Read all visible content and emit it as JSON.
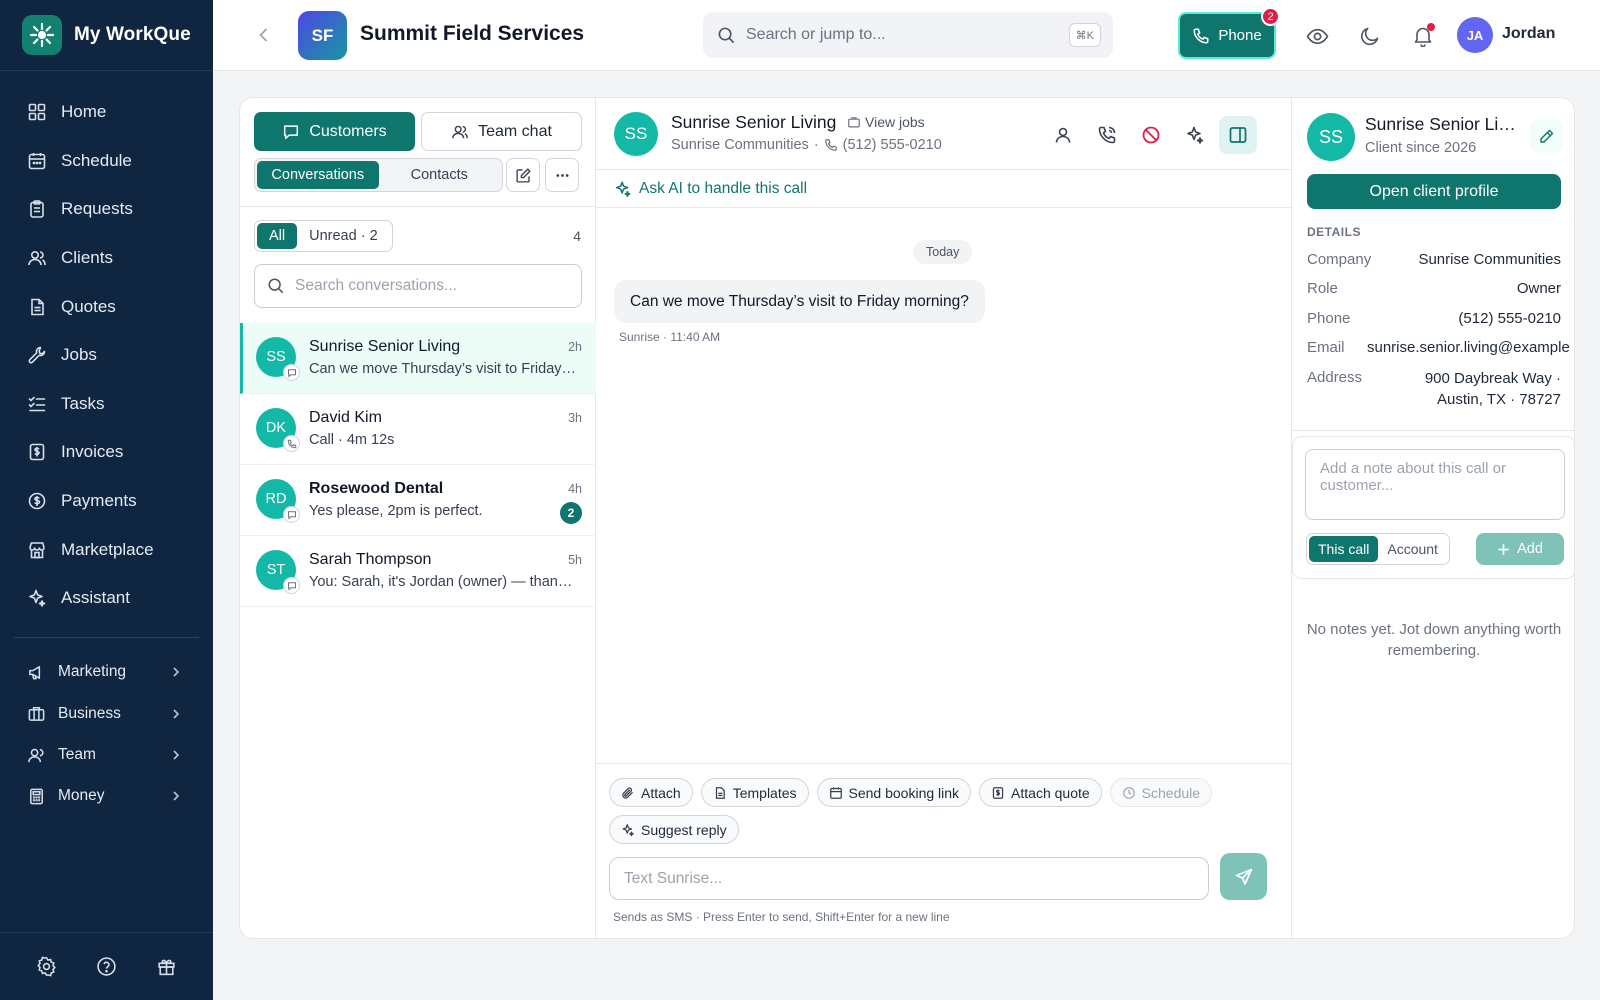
{
  "sidebar": {
    "brand": "My WorkQue",
    "items": [
      {
        "label": "Home",
        "icon": "home-icon"
      },
      {
        "label": "Schedule",
        "icon": "calendar-icon"
      },
      {
        "label": "Requests",
        "icon": "clipboard-icon"
      },
      {
        "label": "Clients",
        "icon": "users-icon"
      },
      {
        "label": "Quotes",
        "icon": "document-icon"
      },
      {
        "label": "Jobs",
        "icon": "wrench-icon"
      },
      {
        "label": "Tasks",
        "icon": "checklist-icon"
      },
      {
        "label": "Invoices",
        "icon": "invoice-icon"
      },
      {
        "label": "Payments",
        "icon": "dollar-circle-icon"
      },
      {
        "label": "Marketplace",
        "icon": "store-icon"
      },
      {
        "label": "Assistant",
        "icon": "sparkle-icon"
      }
    ],
    "groups": [
      {
        "label": "Marketing",
        "icon": "megaphone-icon"
      },
      {
        "label": "Business",
        "icon": "briefcase-icon"
      },
      {
        "label": "Team",
        "icon": "user-icon"
      },
      {
        "label": "Money",
        "icon": "calculator-icon"
      }
    ]
  },
  "topbar": {
    "org_initials": "SF",
    "org_name": "Summit Field Services",
    "search_placeholder": "Search or jump to...",
    "shortcut": "⌘K",
    "phone_label": "Phone",
    "phone_badge": "2",
    "user_initials": "JA",
    "user_name": "Jordan"
  },
  "left": {
    "tab_customers": "Customers",
    "tab_team_chat": "Team chat",
    "sub_conversations": "Conversations",
    "sub_contacts": "Contacts",
    "filter_all": "All",
    "filter_unread": "Unread · 2",
    "count": "4",
    "search_placeholder": "Search conversations...",
    "conversations": [
      {
        "initials": "SS",
        "name": "Sunrise Senior Living",
        "time": "2h",
        "preview": "Can we move Thursday’s visit to Friday morning?",
        "channel": "chat-bubble-icon"
      },
      {
        "initials": "DK",
        "name": "David Kim",
        "time": "3h",
        "preview": "Call · 4m 12s",
        "channel": "phone-icon"
      },
      {
        "initials": "RD",
        "name": "Rosewood Dental",
        "time": "4h",
        "preview": "Yes please, 2pm is perfect.",
        "channel": "chat-bubble-icon",
        "unread": "2"
      },
      {
        "initials": "ST",
        "name": "Sarah Thompson",
        "time": "5h",
        "preview": "You: Sarah, it's Jordan (owner) — thanks for reaching out",
        "channel": "chat-bubble-icon"
      }
    ]
  },
  "middle": {
    "initials": "SS",
    "name": "Sunrise Senior Living",
    "view_jobs": "View jobs",
    "company": "Sunrise Communities",
    "sep": "·",
    "phone": "(512) 555-0210",
    "ai_label": "Ask AI to handle this call",
    "day": "Today",
    "message": "Can we move Thursday’s visit to Friday morning?",
    "message_meta": "Sunrise · 11:40 AM",
    "chips": [
      "Attach",
      "Templates",
      "Send booking link",
      "Attach quote",
      "Schedule",
      "Suggest reply"
    ],
    "input_placeholder": "Text Sunrise...",
    "hint": "Sends as SMS · Press Enter to send, Shift+Enter for a new line"
  },
  "right": {
    "initials": "SS",
    "name": "Sunrise Senior Living",
    "since": "Client since 2026",
    "open_profile": "Open client profile",
    "details_heading": "DETAILS",
    "details": [
      {
        "k": "Company",
        "v": "Sunrise Communities"
      },
      {
        "k": "Role",
        "v": "Owner"
      },
      {
        "k": "Phone",
        "v": "(512) 555-0210"
      },
      {
        "k": "Email",
        "v": "sunrise.senior.living@example"
      },
      {
        "k": "Address",
        "v": "900 Daybreak Way ·",
        "v2": "Austin, TX · 78727"
      }
    ],
    "note_placeholder": "Add a note about this call or customer...",
    "note_this_call": "This call",
    "note_account": "Account",
    "note_add": "Add",
    "no_notes": "No notes yet. Jot down anything worth remembering."
  },
  "colors": {
    "sidebar_bg": "#102540",
    "accent": "#0f766e",
    "avatar": "#14b8a6",
    "alert": "#e11d48"
  }
}
